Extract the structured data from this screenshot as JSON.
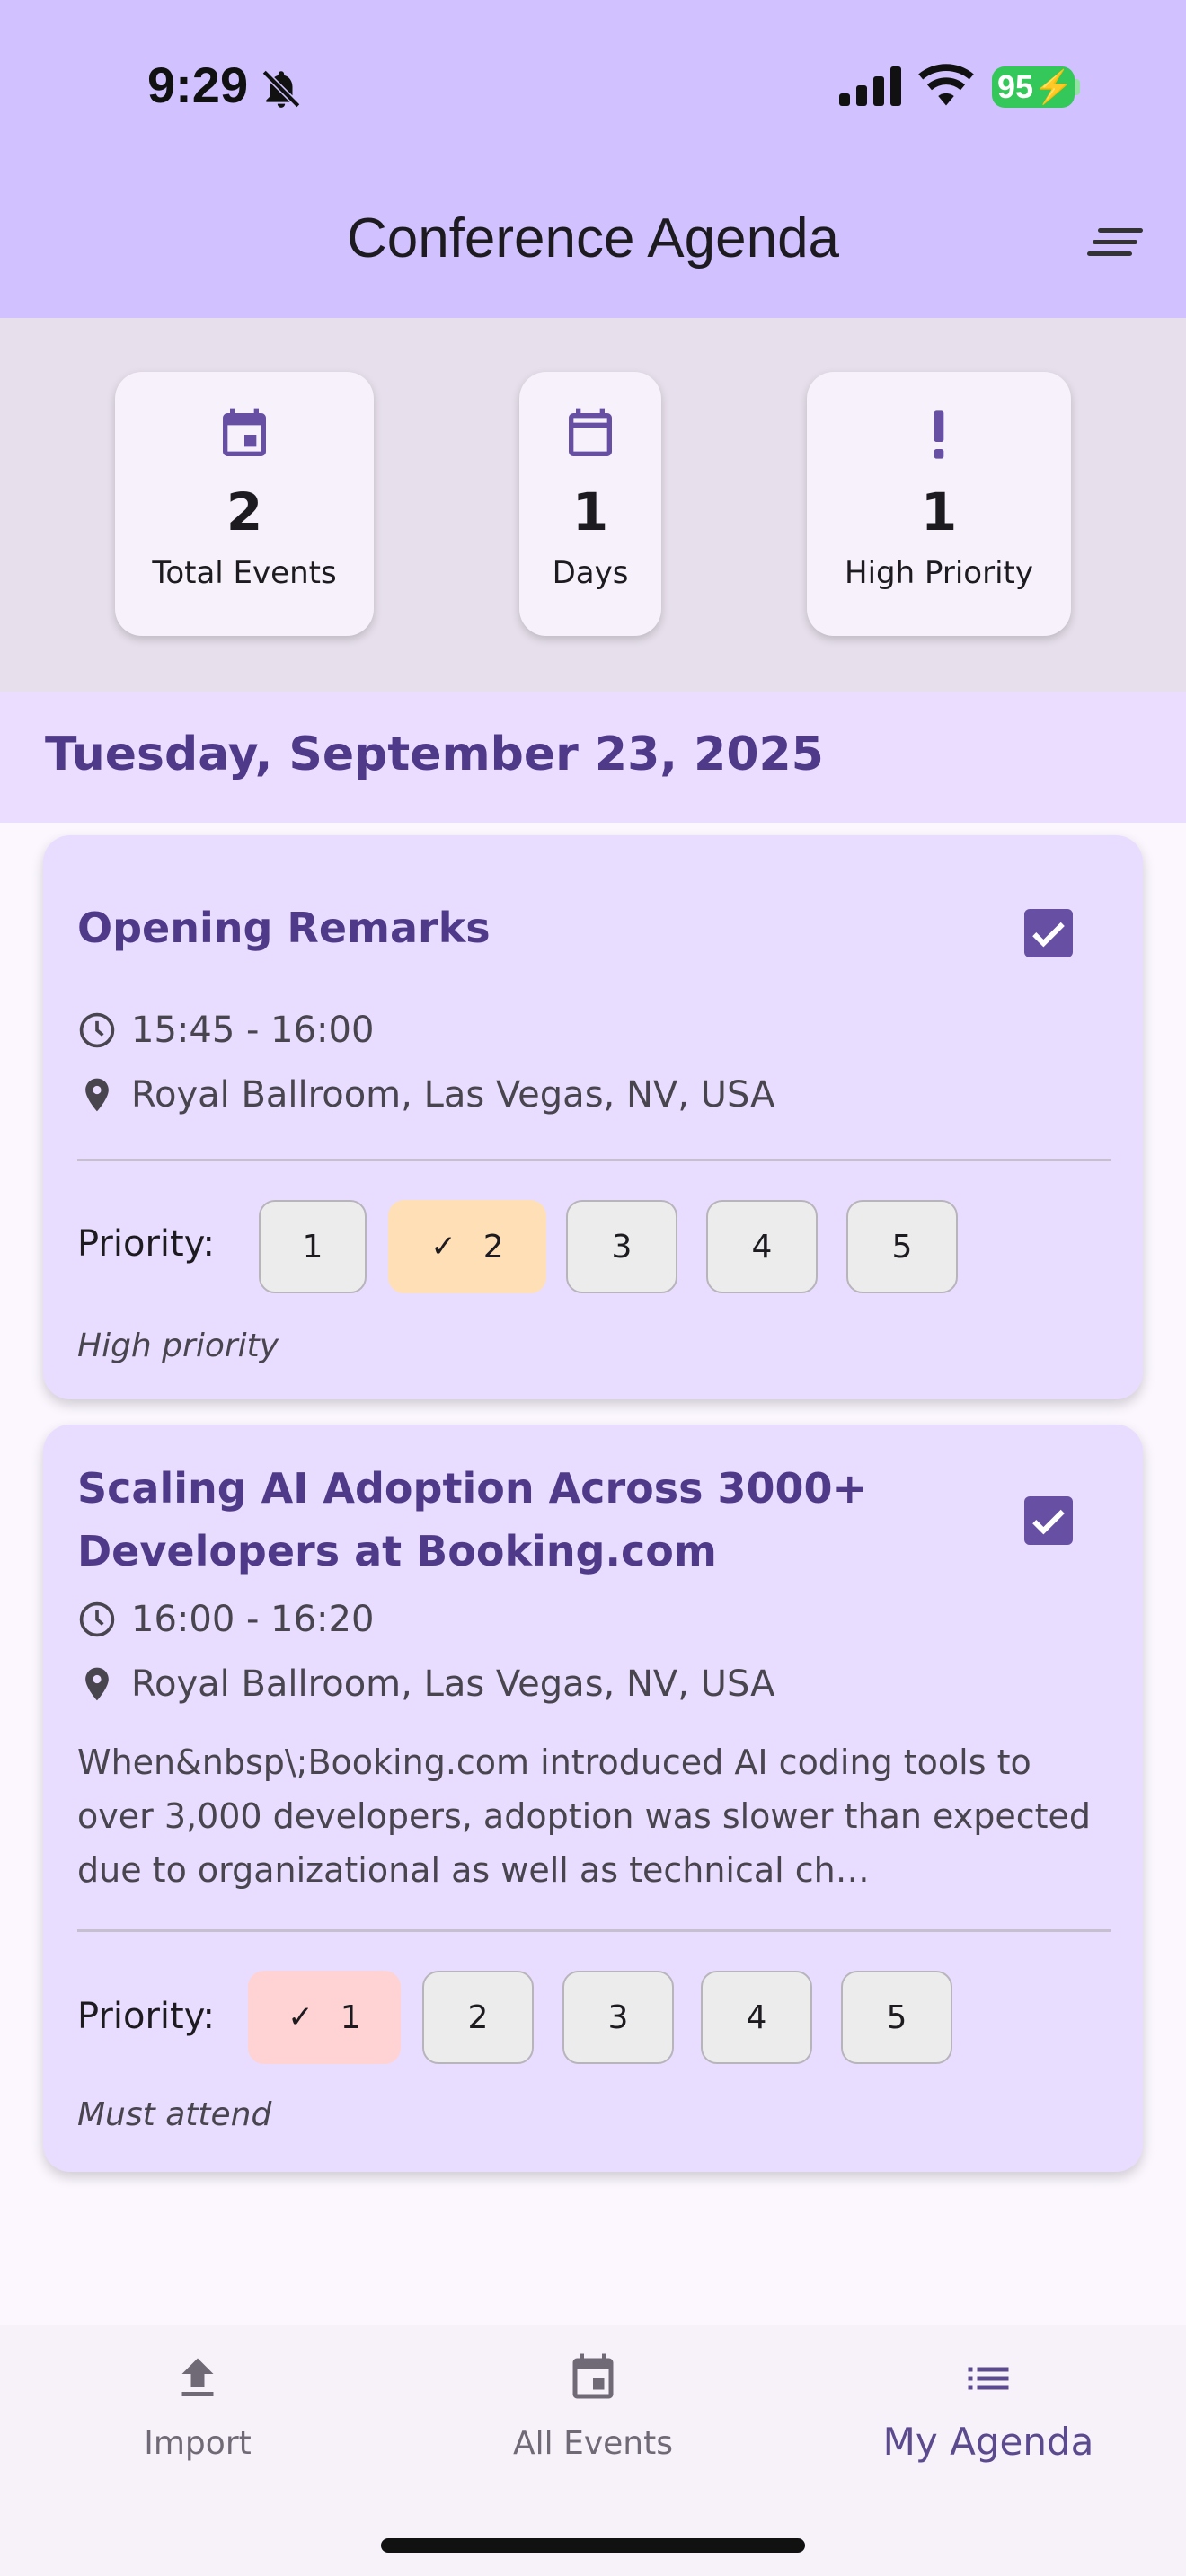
{
  "status_bar": {
    "time": "9:29",
    "battery": "95"
  },
  "app_bar": {
    "title": "Conference Agenda"
  },
  "stats": [
    {
      "icon": "calendar-event-icon",
      "value": "2",
      "label": "Total Events"
    },
    {
      "icon": "calendar-icon",
      "value": "1",
      "label": "Days"
    },
    {
      "icon": "exclamation-icon",
      "value": "1",
      "label": "High Priority"
    }
  ],
  "date_header": "Tuesday, September 23, 2025",
  "events": [
    {
      "title": "Opening Remarks",
      "checked": true,
      "time": "15:45 - 16:00",
      "location": "Royal Ballroom, Las Vegas, NV, USA",
      "priority_label": "Priority:",
      "priority_options": [
        "1",
        "2",
        "3",
        "4",
        "5"
      ],
      "selected_priority": "2",
      "note": "High priority"
    },
    {
      "title": "Scaling AI Adoption Across 3000+ Developers at Booking.com",
      "checked": true,
      "time": "16:00 - 16:20",
      "location": "Royal Ballroom, Las Vegas, NV, USA",
      "description": "When&nbsp\\;Booking.com introduced AI coding tools to over 3,000 developers, adoption was slower than expected due to organizational as well as technical ch…",
      "priority_label": "Priority:",
      "priority_options": [
        "1",
        "2",
        "3",
        "4",
        "5"
      ],
      "selected_priority": "1",
      "note": "Must attend"
    }
  ],
  "bottom_nav": [
    {
      "label": "Import",
      "icon": "upload-icon",
      "active": false
    },
    {
      "label": "All Events",
      "icon": "calendar-icon",
      "active": false
    },
    {
      "label": "My Agenda",
      "icon": "list-icon",
      "active": true
    }
  ],
  "colors": {
    "app_bar": "#d1c2ff",
    "primary": "#6750a4",
    "card": "#e9ddff",
    "priority_2": "#ffdfb5",
    "priority_1": "#ffd3d3"
  }
}
